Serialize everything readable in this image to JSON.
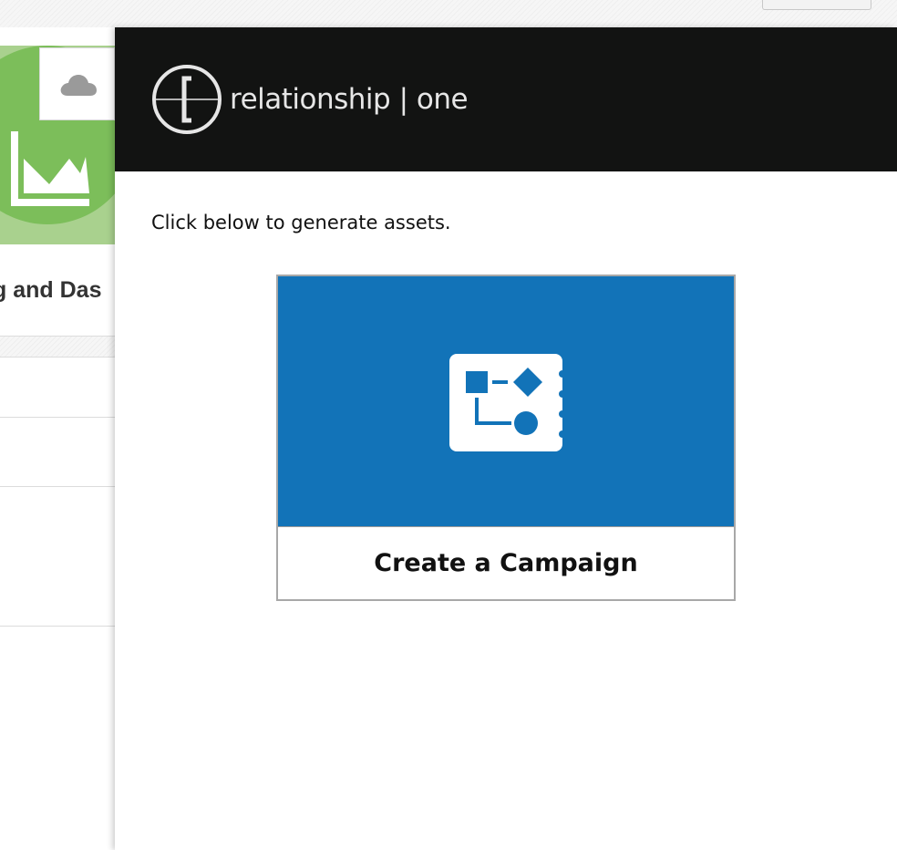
{
  "background_app": {
    "tile_title": "g and Das",
    "tile_icon": "area-chart-icon",
    "cloud_icon": "cloud-icon"
  },
  "panel": {
    "brand": {
      "name": "relationship | one",
      "logo_icon": "relationship-one-logo"
    },
    "instruction": "Click below to generate assets.",
    "campaign_card": {
      "label": "Create a Campaign",
      "icon": "campaign-flow-icon",
      "banner_color": "#1273b8"
    },
    "header_color": "#121312"
  }
}
